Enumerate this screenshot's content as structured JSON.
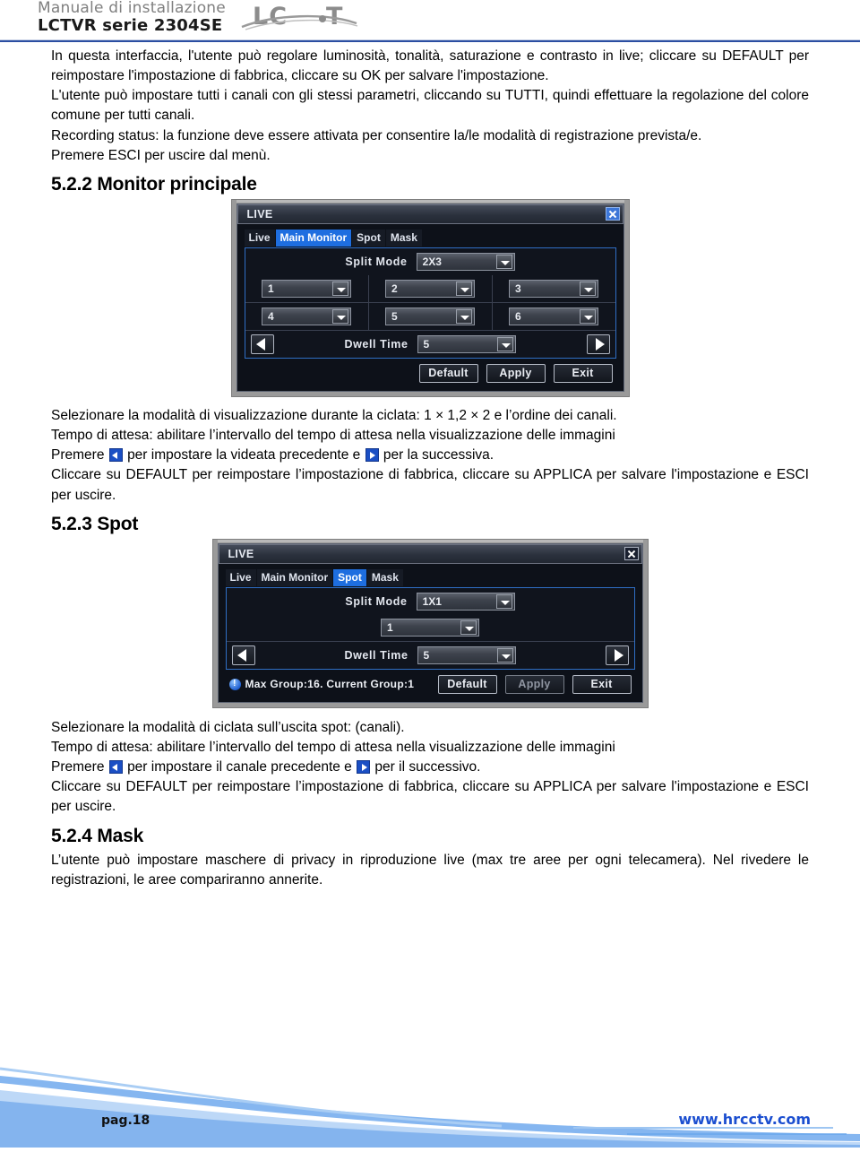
{
  "header": {
    "manual_label": "Manuale di installazione",
    "model_label": "LCTVR serie 2304SE",
    "logo_text": "LCT"
  },
  "intro": {
    "para1": "In questa interfaccia, l'utente può regolare luminosità, tonalità, saturazione e contrasto in live; cliccare su DEFAULT per reimpostare l'impostazione di fabbrica, cliccare su OK per salvare l'impostazione.",
    "para2": "L'utente può impostare tutti i canali con gli stessi parametri, cliccando su TUTTI, quindi effettuare la regolazione del colore comune per tutti canali.",
    "para3": "Recording status: la funzione deve essere attivata per consentire la/le modalità di registrazione prevista/e.",
    "para4": "Premere ESCI per uscire dal menù."
  },
  "section_main_monitor": {
    "heading": "5.2.2 Monitor principale",
    "desc_line1": "Selezionare la modalità di visualizzazione durante la ciclata: 1 × 1,2 × 2 e l’ordine dei canali.",
    "desc_line2": "Tempo di attesa: abilitare l’intervallo del tempo di attesa nella visualizzazione delle immagini",
    "desc_line3_a": "Premere",
    "desc_line3_b": "per impostare la videata precedente e",
    "desc_line3_c": "per la successiva.",
    "desc_line4": "Cliccare su DEFAULT per reimpostare l’impostazione di fabbrica, cliccare su APPLICA per salvare l'impostazione e ESCI per uscire."
  },
  "section_spot": {
    "heading": "5.2.3 Spot",
    "desc_line1": "Selezionare la modalità di ciclata sull’uscita spot: (canali).",
    "desc_line2": "Tempo di attesa: abilitare l’intervallo del tempo di attesa nella visualizzazione delle immagini",
    "desc_line3_a": "Premere",
    "desc_line3_b": "per impostare il canale precedente e",
    "desc_line3_c": "per il successivo.",
    "desc_line4": "Cliccare su DEFAULT per reimpostare l’impostazione di fabbrica, cliccare su APPLICA per salvare l'impostazione e ESCI per uscire."
  },
  "section_mask": {
    "heading": "5.2.4 Mask",
    "desc": "L’utente può impostare maschere di privacy in riproduzione live (max tre aree per ogni telecamera). Nel rivedere le registrazioni, le aree compariranno annerite."
  },
  "dialog_main_monitor": {
    "title": "LIVE",
    "tabs": [
      {
        "label": "Live",
        "active": false
      },
      {
        "label": "Main Monitor",
        "active": true
      },
      {
        "label": "Spot",
        "active": false
      },
      {
        "label": "Mask",
        "active": false
      }
    ],
    "split_mode_label": "Split Mode",
    "split_mode_value": "2X3",
    "channels": [
      "1",
      "2",
      "3",
      "4",
      "5",
      "6"
    ],
    "dwell_label": "Dwell Time",
    "dwell_value": "5",
    "buttons": {
      "default": "Default",
      "apply": "Apply",
      "exit": "Exit"
    }
  },
  "dialog_spot": {
    "title": "LIVE",
    "tabs": [
      {
        "label": "Live",
        "active": false
      },
      {
        "label": "Main Monitor",
        "active": false
      },
      {
        "label": "Spot",
        "active": true
      },
      {
        "label": "Mask",
        "active": false
      }
    ],
    "split_mode_label": "Split Mode",
    "split_mode_value": "1X1",
    "channels": [
      "1"
    ],
    "dwell_label": "Dwell Time",
    "dwell_value": "5",
    "status_note": "Max Group:16. Current Group:1",
    "buttons": {
      "default": "Default",
      "apply": "Apply",
      "exit": "Exit"
    }
  },
  "footer": {
    "page_number": "pag.18",
    "website": "www.hrcctv.com"
  }
}
